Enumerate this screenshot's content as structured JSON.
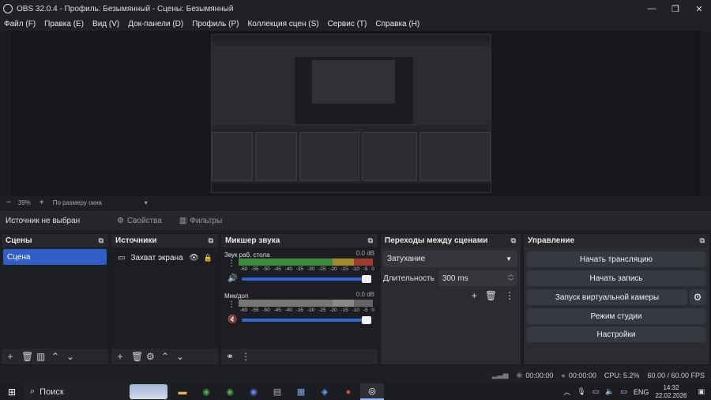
{
  "window": {
    "title": "OBS 32.0.4 - Профиль: Безымянный - Сцены: Безымянный"
  },
  "window_controls": {
    "minimize": "—",
    "maximize": "❐",
    "close": "✕"
  },
  "menu": [
    "Файл (F)",
    "Правка (E)",
    "Вид (V)",
    "Док-панели (D)",
    "Профиль (P)",
    "Коллекция сцен (S)",
    "Сервис (T)",
    "Справка (H)"
  ],
  "zoom": {
    "minus": "−",
    "value": "39%",
    "plus": "+",
    "mode": "По размеру окна",
    "arrow": "▾"
  },
  "source_bar": {
    "no_source": "Источник не выбран",
    "properties": "Свойства",
    "filters": "Фильтры"
  },
  "scenes": {
    "title": "Сцены",
    "items": [
      "Сцена"
    ]
  },
  "sources": {
    "title": "Источники",
    "items": [
      {
        "name": "Захват экрана",
        "visible": true,
        "locked": true
      }
    ]
  },
  "mixer": {
    "title": "Микшер звука",
    "ticks": [
      "-60",
      "-55",
      "-50",
      "-45",
      "-40",
      "-35",
      "-30",
      "-25",
      "-20",
      "-15",
      "-10",
      "-5",
      "0"
    ],
    "channels": [
      {
        "name": "Звук раб. стола",
        "db": "0.0 dB",
        "level": 1.0,
        "volume": 1.0,
        "muted": false
      },
      {
        "name": "Мик/доп",
        "db": "0.0 dB",
        "level": 1.0,
        "volume": 1.0,
        "muted": true
      }
    ]
  },
  "transitions": {
    "title": "Переходы между сценами",
    "selected": "Затухание",
    "duration_label": "Длительность",
    "duration": "300 ms"
  },
  "controls": {
    "title": "Управление",
    "buttons": [
      "Начать трансляцию",
      "Начать запись",
      "Запуск виртуальной камеры",
      "Режим студии",
      "Настройки"
    ]
  },
  "status": {
    "stream_time": "00:00:00",
    "rec_time": "00:00:00",
    "cpu": "CPU: 5.2%",
    "fps": "60.00 / 60.00 FPS"
  },
  "taskbar": {
    "search": "Поиск",
    "lang": "ENG",
    "time": "14:32",
    "date": "22.02.2026"
  },
  "colors": {
    "accent": "#2f5ec9",
    "bg": "#1e1f22",
    "panel": "#2a2c30"
  }
}
